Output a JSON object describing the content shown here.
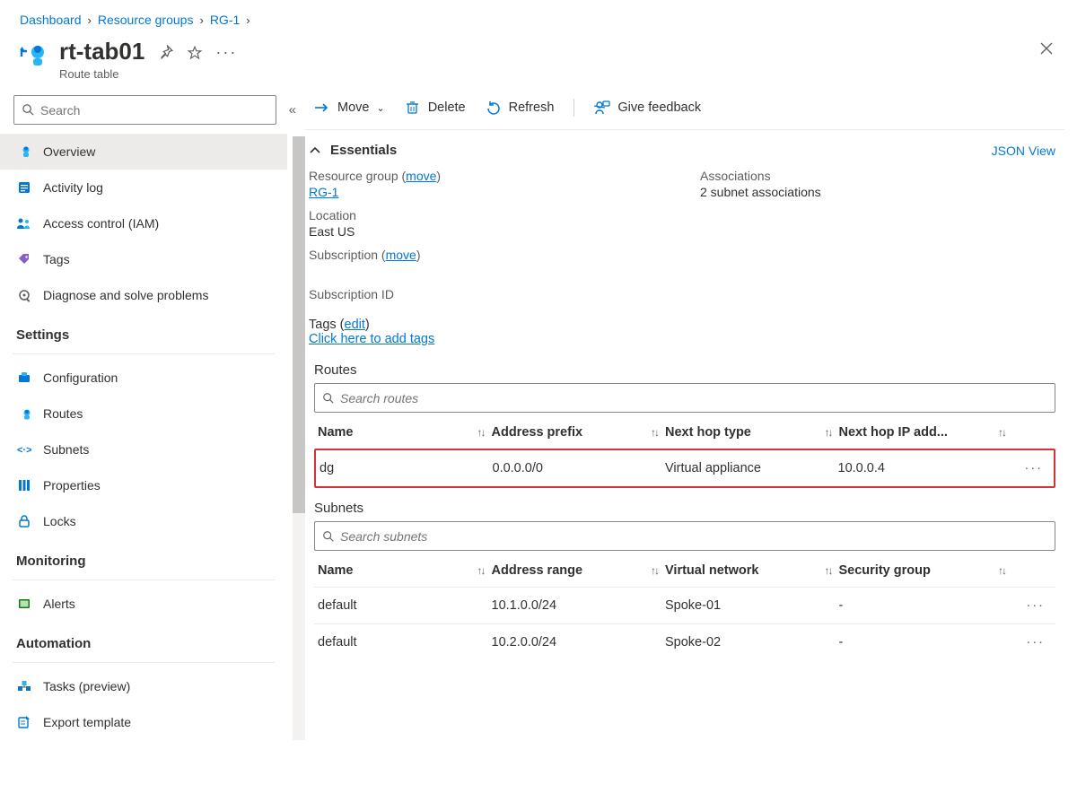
{
  "breadcrumb": {
    "item1": "Dashboard",
    "item2": "Resource groups",
    "item3": "RG-1"
  },
  "header": {
    "title": "rt-tab01",
    "subtitle": "Route table"
  },
  "search": {
    "placeholder": "Search"
  },
  "nav": {
    "overview": "Overview",
    "activity": "Activity log",
    "iam": "Access control (IAM)",
    "tags": "Tags",
    "diagnose": "Diagnose and solve problems",
    "settings_h": "Settings",
    "config": "Configuration",
    "routes": "Routes",
    "subnets": "Subnets",
    "properties": "Properties",
    "locks": "Locks",
    "monitoring_h": "Monitoring",
    "alerts": "Alerts",
    "automation_h": "Automation",
    "tasks": "Tasks (preview)",
    "export": "Export template"
  },
  "toolbar": {
    "move": "Move",
    "delete": "Delete",
    "refresh": "Refresh",
    "feedback": "Give feedback"
  },
  "essentials": {
    "label": "Essentials",
    "json": "JSON View",
    "rg_label": "Resource group (",
    "rg_move": "move",
    "rg_close": ")",
    "rg_val": "RG-1",
    "loc_label": "Location",
    "loc_val": "East US",
    "sub_label": "Subscription (",
    "sub_move": "move",
    "sub_close": ")",
    "subid_label": "Subscription ID",
    "assoc_label": "Associations",
    "assoc_val": "2 subnet associations",
    "tags_label": "Tags (",
    "tags_edit": "edit",
    "tags_close": ")",
    "tags_add": "Click here to add tags"
  },
  "routes": {
    "title": "Routes",
    "filter": "Search routes",
    "cols": {
      "name": "Name",
      "prefix": "Address prefix",
      "hoptype": "Next hop type",
      "hopip": "Next hop IP add..."
    },
    "rows": [
      {
        "name": "dg",
        "prefix": "0.0.0.0/0",
        "hoptype": "Virtual appliance",
        "hopip": "10.0.0.4"
      }
    ]
  },
  "subnets": {
    "title": "Subnets",
    "filter": "Search subnets",
    "cols": {
      "name": "Name",
      "range": "Address range",
      "vnet": "Virtual network",
      "nsg": "Security group"
    },
    "rows": [
      {
        "name": "default",
        "range": "10.1.0.0/24",
        "vnet": "Spoke-01",
        "nsg": "-"
      },
      {
        "name": "default",
        "range": "10.2.0.0/24",
        "vnet": "Spoke-02",
        "nsg": "-"
      }
    ]
  }
}
